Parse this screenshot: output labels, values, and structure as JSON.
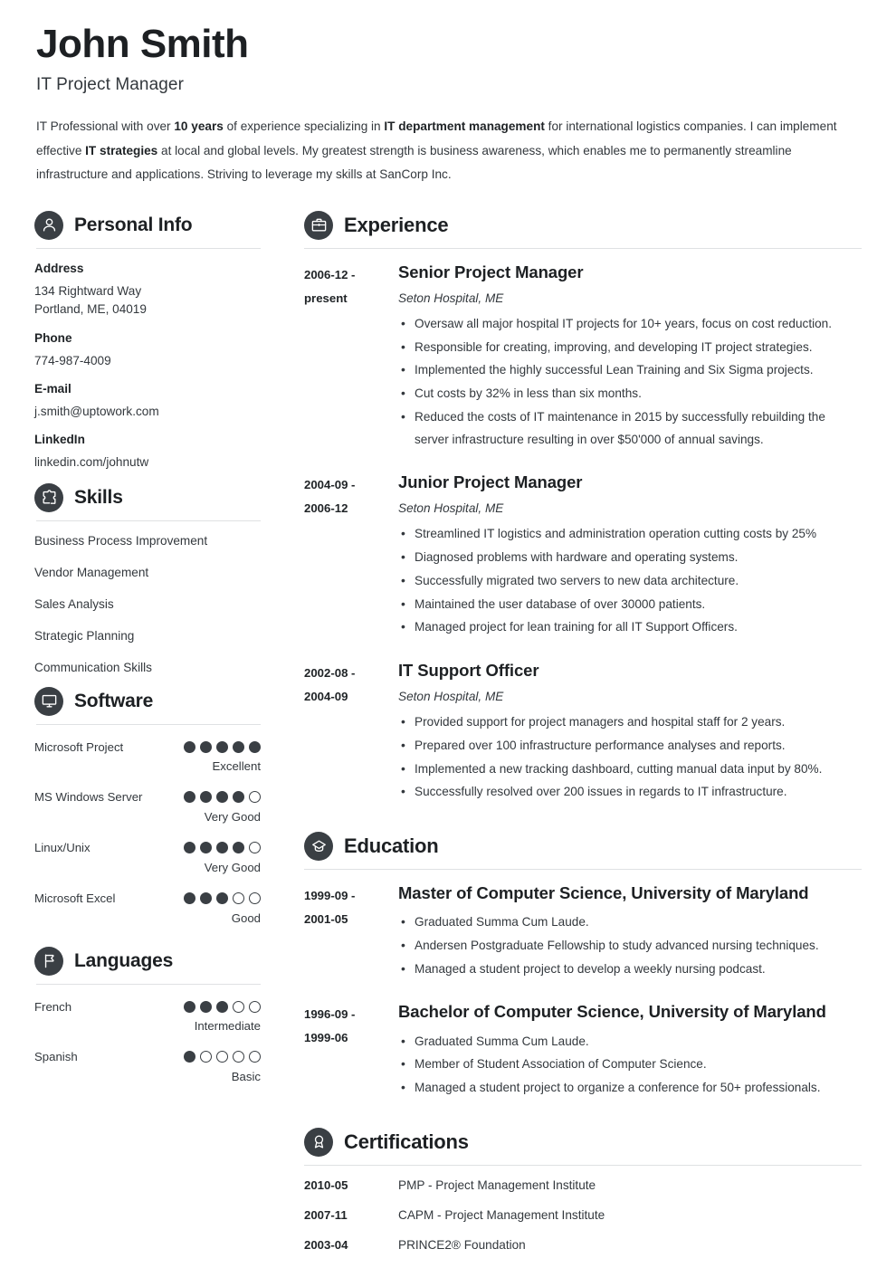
{
  "header": {
    "name": "John Smith",
    "job_title": "IT Project Manager",
    "summary_parts": [
      {
        "text": "IT Professional with over ",
        "bold": false
      },
      {
        "text": "10 years",
        "bold": true
      },
      {
        "text": " of experience specializing in ",
        "bold": false
      },
      {
        "text": "IT department management",
        "bold": true
      },
      {
        "text": " for international logistics companies. I can implement effective ",
        "bold": false
      },
      {
        "text": "IT strategies",
        "bold": true
      },
      {
        "text": " at local and global levels. My greatest strength is business awareness, which enables me to permanently streamline infrastructure and applications. Striving to leverage my skills at SanCorp Inc.",
        "bold": false
      }
    ]
  },
  "personal_info": {
    "section_title": "Personal Info",
    "icon": "person-icon",
    "fields": [
      {
        "label": "Address",
        "value": "134 Rightward Way\nPortland, ME, 04019"
      },
      {
        "label": "Phone",
        "value": "774-987-4009"
      },
      {
        "label": "E-mail",
        "value": "j.smith@uptowork.com"
      },
      {
        "label": "LinkedIn",
        "value": "linkedin.com/johnutw"
      }
    ]
  },
  "skills": {
    "section_title": "Skills",
    "icon": "puzzle-icon",
    "items": [
      "Business Process Improvement",
      "Vendor Management",
      "Sales Analysis",
      "Strategic Planning",
      "Communication Skills"
    ]
  },
  "software": {
    "section_title": "Software",
    "icon": "monitor-icon",
    "max_rating": 5,
    "items": [
      {
        "name": "Microsoft Project",
        "rating": 5,
        "level": "Excellent"
      },
      {
        "name": "MS Windows Server",
        "rating": 4,
        "level": "Very Good"
      },
      {
        "name": "Linux/Unix",
        "rating": 4,
        "level": "Very Good"
      },
      {
        "name": "Microsoft Excel",
        "rating": 3,
        "level": "Good"
      }
    ]
  },
  "languages": {
    "section_title": "Languages",
    "icon": "flag-icon",
    "max_rating": 5,
    "items": [
      {
        "name": "French",
        "rating": 3,
        "level": "Intermediate"
      },
      {
        "name": "Spanish",
        "rating": 1,
        "level": "Basic"
      }
    ]
  },
  "experience": {
    "section_title": "Experience",
    "icon": "briefcase-icon",
    "entries": [
      {
        "date": "2006-12 -\npresent",
        "title": "Senior Project Manager",
        "subtitle": "Seton Hospital, ME",
        "bullets": [
          "Oversaw all major hospital IT projects for 10+ years, focus on cost reduction.",
          "Responsible for creating, improving, and developing IT project strategies.",
          "Implemented the highly successful Lean Training and Six Sigma projects.",
          "Cut costs by 32% in less than six months.",
          "Reduced the costs of IT maintenance in 2015 by successfully rebuilding the server infrastructure resulting in over $50'000 of annual savings."
        ]
      },
      {
        "date": "2004-09 -\n2006-12",
        "title": "Junior Project Manager",
        "subtitle": "Seton Hospital, ME",
        "bullets": [
          "Streamlined IT logistics and administration operation cutting costs by 25%",
          "Diagnosed problems with hardware and operating systems.",
          "Successfully migrated two servers to new data architecture.",
          "Maintained the user database of over 30000 patients.",
          "Managed project for lean training for all IT Support Officers."
        ]
      },
      {
        "date": "2002-08 -\n2004-09",
        "title": "IT Support Officer",
        "subtitle": "Seton Hospital, ME",
        "bullets": [
          "Provided support for project managers and hospital staff for 2 years.",
          "Prepared over 100 infrastructure performance analyses and reports.",
          "Implemented a new tracking dashboard, cutting manual data input by 80%.",
          "Successfully resolved over 200 issues in regards to IT infrastructure."
        ]
      }
    ]
  },
  "education": {
    "section_title": "Education",
    "icon": "graduation-icon",
    "entries": [
      {
        "date": "1999-09 -\n2001-05",
        "title": "Master of Computer Science, University of Maryland",
        "bullets": [
          "Graduated Summa Cum Laude.",
          "Andersen Postgraduate Fellowship to study advanced nursing techniques.",
          "Managed a student project to develop a weekly nursing podcast."
        ]
      },
      {
        "date": "1996-09 -\n1999-06",
        "title": "Bachelor of Computer Science, University of Maryland",
        "bullets": [
          "Graduated Summa Cum Laude.",
          "Member of Student Association of Computer Science.",
          "Managed a student project to organize a conference for 50+ professionals."
        ]
      }
    ]
  },
  "certifications": {
    "section_title": "Certifications",
    "icon": "award-icon",
    "entries": [
      {
        "date": "2010-05",
        "text": "PMP - Project Management Institute"
      },
      {
        "date": "2007-11",
        "text": "CAPM - Project Management Institute"
      },
      {
        "date": "2003-04",
        "text": "PRINCE2® Foundation"
      }
    ]
  },
  "colors": {
    "ink": "#2f3337",
    "heading": "#1d2023",
    "icon_bg": "#3a3f44",
    "rule": "#dfe1e3",
    "background": "#ffffff"
  }
}
